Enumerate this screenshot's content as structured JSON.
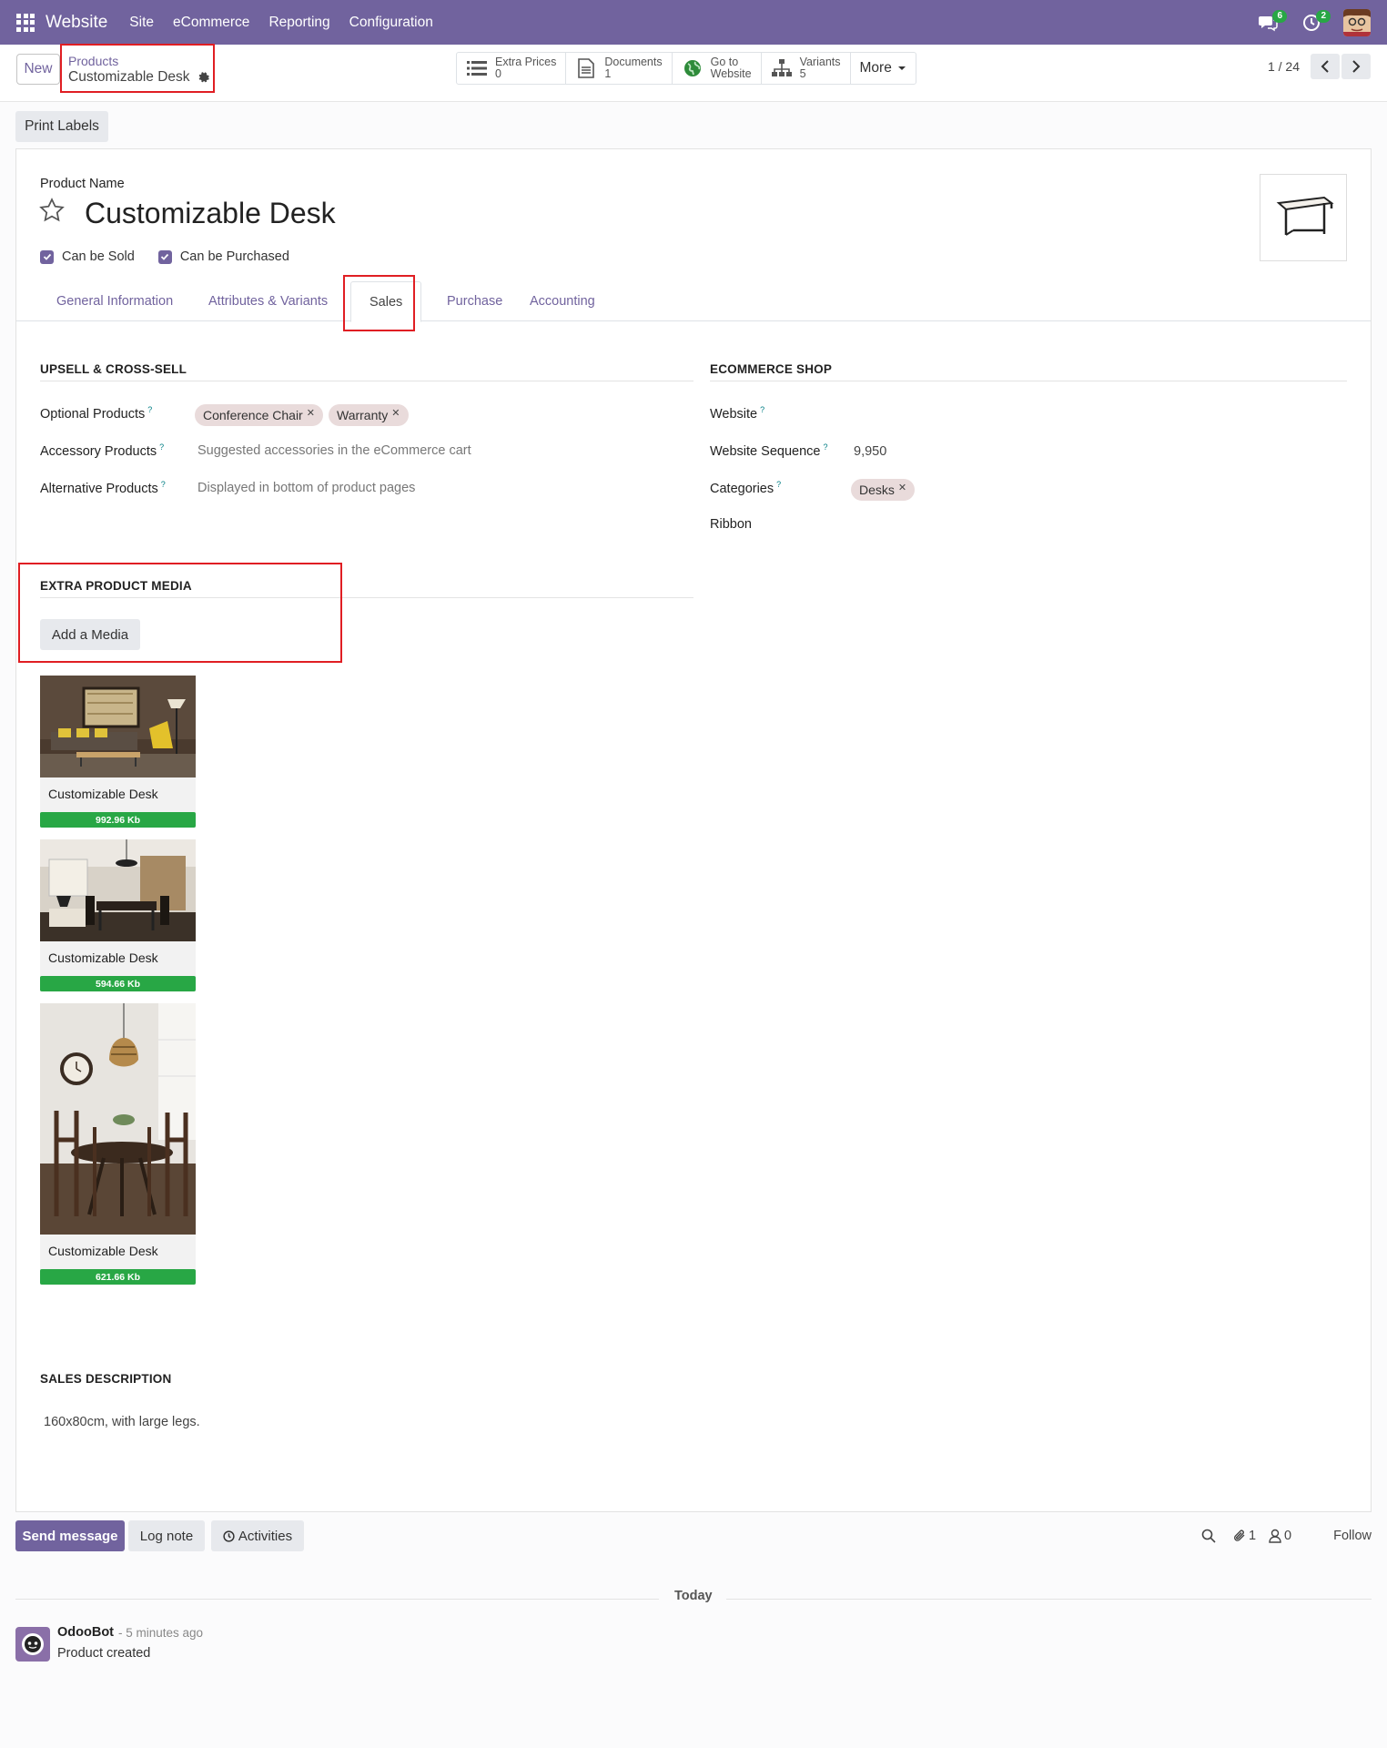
{
  "topnav": {
    "app_name": "Website",
    "menu": [
      "Site",
      "eCommerce",
      "Reporting",
      "Configuration"
    ],
    "messages_count": "6",
    "activities_count": "2",
    "bg_color": "#71639e"
  },
  "control": {
    "new_label": "New",
    "breadcrumb_parent": "Products",
    "breadcrumb_current": "Customizable Desk",
    "smart_buttons": [
      {
        "icon": "list-icon",
        "title": "Extra Prices",
        "value": "0"
      },
      {
        "icon": "document-icon",
        "title": "Documents",
        "value": "1"
      },
      {
        "icon": "globe-icon",
        "title": "Go to",
        "value": "Website"
      },
      {
        "icon": "sitemap-icon",
        "title": "Variants",
        "value": "5"
      }
    ],
    "more_label": "More",
    "pager": "1 / 24"
  },
  "print_labels": "Print Labels",
  "form": {
    "product_name_label": "Product Name",
    "product_name": "Customizable Desk",
    "can_be_sold": "Can be Sold",
    "can_be_purchased": "Can be Purchased",
    "tabs": [
      "General Information",
      "Attributes & Variants",
      "Sales",
      "Purchase",
      "Accounting"
    ],
    "active_tab": "Sales",
    "upsell": {
      "title": "UPSELL & CROSS-SELL",
      "optional_label": "Optional Products",
      "optional_tags": [
        "Conference Chair",
        "Warranty"
      ],
      "accessory_label": "Accessory Products",
      "accessory_placeholder": "Suggested accessories in the eCommerce cart",
      "alternative_label": "Alternative Products",
      "alternative_placeholder": "Displayed in bottom of product pages"
    },
    "ecommerce": {
      "title": "ECOMMERCE SHOP",
      "website_label": "Website",
      "sequence_label": "Website Sequence",
      "sequence_value": "9,950",
      "categories_label": "Categories",
      "category_tag": "Desks",
      "ribbon_label": "Ribbon"
    },
    "media": {
      "title": "EXTRA PRODUCT MEDIA",
      "add_label": "Add a Media",
      "items": [
        {
          "name": "Customizable Desk",
          "size": "992.96 Kb"
        },
        {
          "name": "Customizable Desk",
          "size": "594.66 Kb"
        },
        {
          "name": "Customizable Desk",
          "size": "621.66 Kb"
        }
      ]
    },
    "sales_description": {
      "title": "SALES DESCRIPTION",
      "text": "160x80cm, with large legs."
    }
  },
  "chatter": {
    "send_message": "Send message",
    "log_note": "Log note",
    "activities": "Activities",
    "attachments_count": "1",
    "followers_count": "0",
    "follow_label": "Follow",
    "today_label": "Today",
    "message": {
      "author": "OdooBot",
      "time": "- 5 minutes ago",
      "body": "Product created"
    }
  }
}
